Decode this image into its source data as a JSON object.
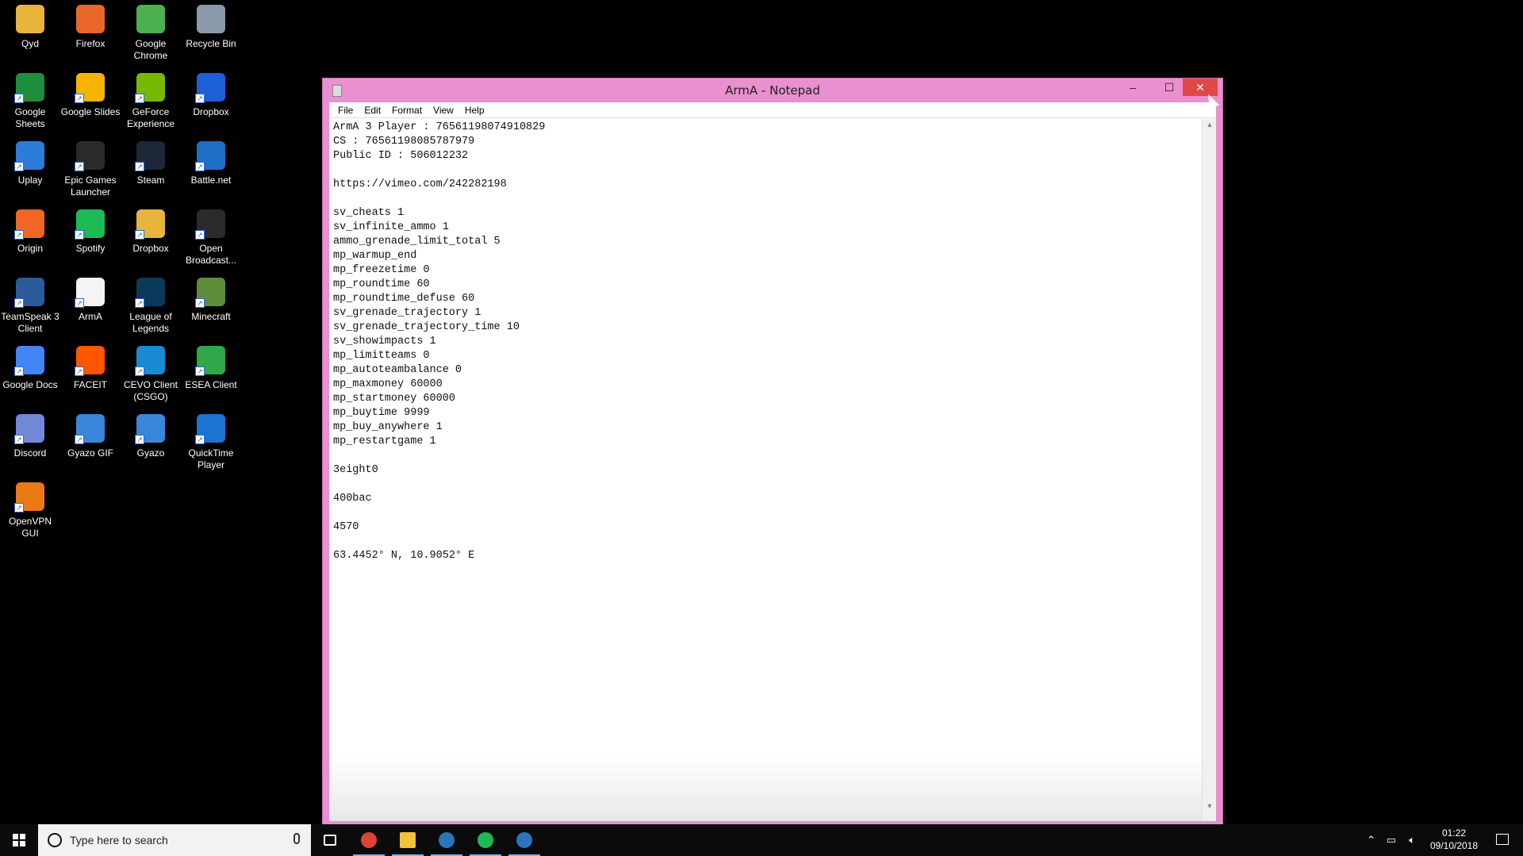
{
  "desktop": {
    "icons": [
      {
        "label": "Qyd",
        "color": "#e8b43c"
      },
      {
        "label": "Firefox",
        "color": "#e8662a"
      },
      {
        "label": "Google Chrome",
        "color": "#4caf50"
      },
      {
        "label": "Recycle Bin",
        "color": "#8a9aa8"
      },
      {
        "label": "Google Sheets",
        "color": "#1e8e3e"
      },
      {
        "label": "Google Slides",
        "color": "#f4b400"
      },
      {
        "label": "GeForce Experience",
        "color": "#76b900"
      },
      {
        "label": "Dropbox",
        "color": "#1e5fd8"
      },
      {
        "label": "Uplay",
        "color": "#2d7cd8"
      },
      {
        "label": "Epic Games Launcher",
        "color": "#2a2a2a"
      },
      {
        "label": "Steam",
        "color": "#1b2838"
      },
      {
        "label": "Battle.net",
        "color": "#1d6ec5"
      },
      {
        "label": "Origin",
        "color": "#f26522"
      },
      {
        "label": "Spotify",
        "color": "#1db954"
      },
      {
        "label": "Dropbox",
        "color": "#e8b43c"
      },
      {
        "label": "Open Broadcast...",
        "color": "#2a2a2a"
      },
      {
        "label": "TeamSpeak 3 Client",
        "color": "#2b5b9a"
      },
      {
        "label": "ArmA",
        "color": "#f4f4f4"
      },
      {
        "label": "League of Legends",
        "color": "#0a3a5a"
      },
      {
        "label": "Minecraft",
        "color": "#5d8c3a"
      },
      {
        "label": "Google Docs",
        "color": "#4285f4"
      },
      {
        "label": "FACEIT",
        "color": "#ff5500"
      },
      {
        "label": "CEVO Client (CSGO)",
        "color": "#1a8ad1"
      },
      {
        "label": "ESEA Client",
        "color": "#2fa74a"
      },
      {
        "label": "Discord",
        "color": "#7289da"
      },
      {
        "label": "Gyazo GIF",
        "color": "#3a86d8"
      },
      {
        "label": "Gyazo",
        "color": "#3a86d8"
      },
      {
        "label": "QuickTime Player",
        "color": "#1b74d1"
      },
      {
        "label": "OpenVPN GUI",
        "color": "#ea7a14"
      }
    ]
  },
  "window": {
    "title": "ArmA - Notepad",
    "title_color": "#ea8fd0",
    "menu": [
      "File",
      "Edit",
      "Format",
      "View",
      "Help"
    ],
    "controls": {
      "minimize": "–",
      "maximize": "☐",
      "close": "✕"
    },
    "lines": [
      "ArmA 3 Player : 76561198074910829",
      "CS : 76561198085787979",
      "Public ID : 506012232",
      "",
      "https://vimeo.com/242282198",
      "",
      "sv_cheats 1",
      "sv_infinite_ammo 1",
      "ammo_grenade_limit_total 5",
      "mp_warmup_end",
      "mp_freezetime 0",
      "mp_roundtime 60",
      "mp_roundtime_defuse 60",
      "sv_grenade_trajectory 1",
      "sv_grenade_trajectory_time 10",
      "sv_showimpacts 1",
      "mp_limitteams 0",
      "mp_autoteambalance 0",
      "mp_maxmoney 60000",
      "mp_startmoney 60000",
      "mp_buytime 9999",
      "mp_buy_anywhere 1",
      "mp_restartgame 1",
      "",
      "3eight0",
      "",
      "400bac",
      "",
      "4570",
      "",
      "63.4452° N, 10.9052° E"
    ]
  },
  "taskbar": {
    "search_placeholder": "Type here to search",
    "apps": [
      {
        "name": "task-view",
        "color": "#ffffff"
      },
      {
        "name": "chrome",
        "color": "#db4437"
      },
      {
        "name": "file-explorer",
        "color": "#f3c13a"
      },
      {
        "name": "steam",
        "color": "#2a75bb"
      },
      {
        "name": "spotify",
        "color": "#1db954"
      },
      {
        "name": "steam",
        "color": "#2a75bb"
      }
    ],
    "time": "01:22",
    "date": "09/10/2018"
  }
}
